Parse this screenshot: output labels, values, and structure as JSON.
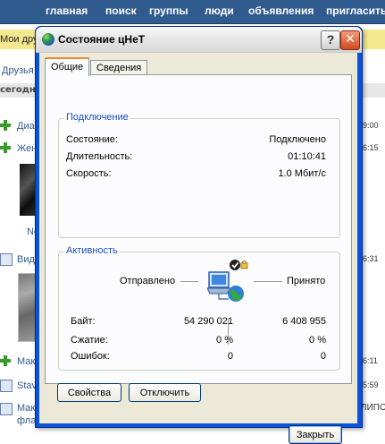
{
  "background_page": {
    "nav": [
      "главная",
      "поиск",
      "группы",
      "люди",
      "объявления",
      "пригласить"
    ],
    "friends_bar_label": "Мои дру",
    "friends_label": "Друзья",
    "date_label": "сегодня",
    "feed_items": [
      {
        "text": "Диа",
        "time": "9:00"
      },
      {
        "text": "Жен",
        "time": "6:15"
      },
      {
        "text": "Ne",
        "time": ""
      },
      {
        "text": "Вид",
        "time": "6:31"
      },
      {
        "text": "Мак",
        "time": "6:11"
      },
      {
        "text": "Stav",
        "time": "5:59"
      },
      {
        "text": "Мак",
        "time": ""
      },
      {
        "text": "фла",
        "time": ""
      }
    ],
    "right_fragment": "ЛИПО"
  },
  "window": {
    "title": "Состояние цНеТ",
    "help_label": "?",
    "close_label": "✕",
    "tabs": [
      "Общие",
      "Сведения"
    ],
    "connection": {
      "group_title": "Подключение",
      "rows": [
        {
          "label": "Состояние:",
          "value": "Подключено"
        },
        {
          "label": "Длительность:",
          "value": "01:10:41"
        },
        {
          "label": "Скорость:",
          "value": "1.0 Мбит/с"
        }
      ]
    },
    "activity": {
      "group_title": "Активность",
      "sent_label": "Отправлено",
      "received_label": "Принято",
      "rows": [
        {
          "label": "Байт:",
          "sent": "54 290 021",
          "received": "6 408 955"
        },
        {
          "label": "Сжатие:",
          "sent": "0 %",
          "received": "0 %"
        },
        {
          "label": "Ошибок:",
          "sent": "0",
          "received": "0"
        }
      ]
    },
    "buttons": {
      "properties": "Свойства",
      "disable": "Отключить",
      "close": "Закрыть"
    }
  }
}
